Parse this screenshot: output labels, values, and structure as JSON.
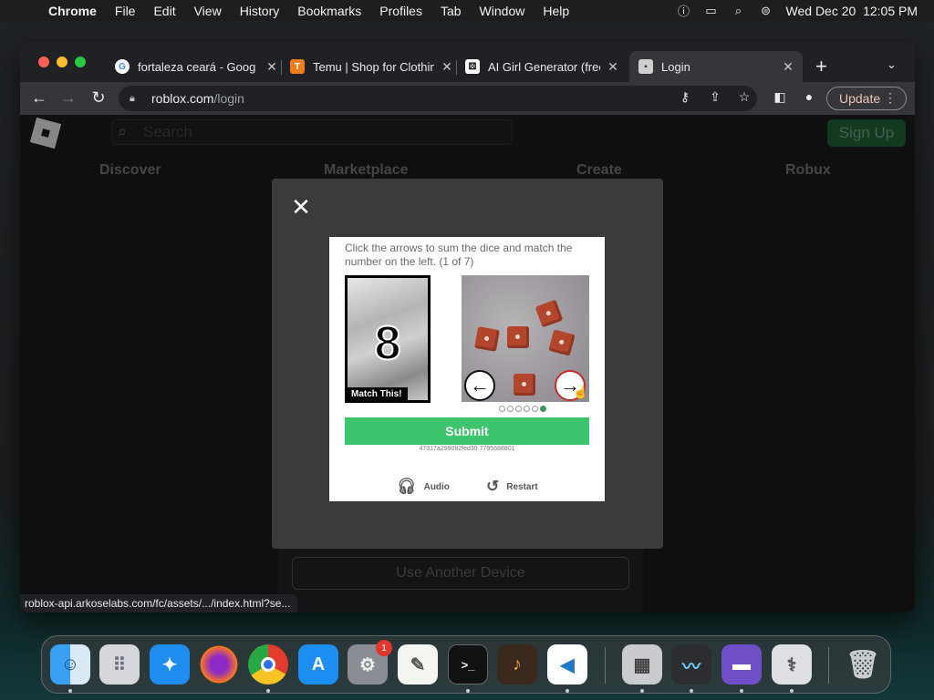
{
  "menubar": {
    "app_name": "Chrome",
    "menus": [
      "File",
      "Edit",
      "View",
      "History",
      "Bookmarks",
      "Profiles",
      "Tab",
      "Window",
      "Help"
    ],
    "datetime": "Wed Dec 20  12:05 PM",
    "status_icons": [
      "info-icon",
      "screen-mirror-icon",
      "spotlight-search-icon",
      "control-center-icon"
    ]
  },
  "browser": {
    "tabs": [
      {
        "title": "fortaleza ceará - Goog",
        "favicon": "google-icon"
      },
      {
        "title": "Temu | Shop for Clothin",
        "favicon": "temu-icon"
      },
      {
        "title": "AI Girl Generator (free",
        "favicon": "dice-icon"
      },
      {
        "title": "Login",
        "favicon": "roblox-icon",
        "active": true
      }
    ],
    "url_host": "roblox.com",
    "url_path": "/login",
    "update_label": "Update",
    "status_url": "roblox-api.arkoselabs.com/fc/assets/.../index.html?se..."
  },
  "roblox": {
    "search_placeholder": "Search",
    "signup_label": "Sign Up",
    "nav": [
      "Discover",
      "Marketplace",
      "Create",
      "Robux"
    ],
    "another_device_label": "Use Another Device",
    "accent_color": "#3ec46d"
  },
  "captcha": {
    "instructions": "Click the arrows to sum the dice and match the number on the left. (1 of 7)",
    "target_number": "8",
    "match_label": "Match This!",
    "submit_label": "Submit",
    "session_id": "47317a299082fed39.7795688801",
    "audio_label": "Audio",
    "restart_label": "Restart",
    "page_indicator": {
      "total": 6,
      "current": 6
    }
  },
  "dock": {
    "apps": [
      "Finder",
      "Launchpad",
      "Safari",
      "Firefox",
      "Chrome",
      "App Store",
      "System Settings",
      "TextEdit",
      "Terminal",
      "GarageBand",
      "Visual Studio Code",
      "Boot Camp Assistant",
      "Activity Monitor",
      "Apple Configurator",
      "Disk Utility",
      "Trash"
    ],
    "settings_badge": "1"
  }
}
